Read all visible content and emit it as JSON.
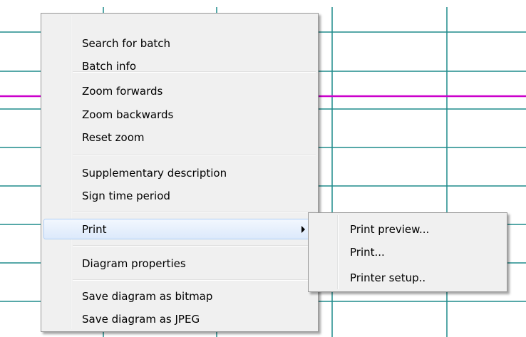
{
  "chart_background": {
    "grid_color": "#1f8c8c",
    "highlight_line_color": "#cc00cc"
  },
  "context_menu": {
    "items": [
      {
        "label": "Search for batch"
      },
      {
        "label": "Batch info"
      },
      {
        "label": "Zoom forwards"
      },
      {
        "label": "Zoom backwards"
      },
      {
        "label": "Reset zoom"
      },
      {
        "label": "Supplementary description"
      },
      {
        "label": "Sign time period"
      },
      {
        "label": "Print",
        "has_submenu": true,
        "highlighted": true
      },
      {
        "label": "Diagram properties"
      },
      {
        "label": "Save diagram as bitmap"
      },
      {
        "label": "Save diagram as JPEG"
      }
    ],
    "highlight_color": "#dce9fb",
    "submenu_arrow_icon": "chevron-right-icon"
  },
  "print_submenu": {
    "items": [
      {
        "label": "Print preview..."
      },
      {
        "label": "Print..."
      },
      {
        "label": "Printer setup.."
      }
    ]
  }
}
